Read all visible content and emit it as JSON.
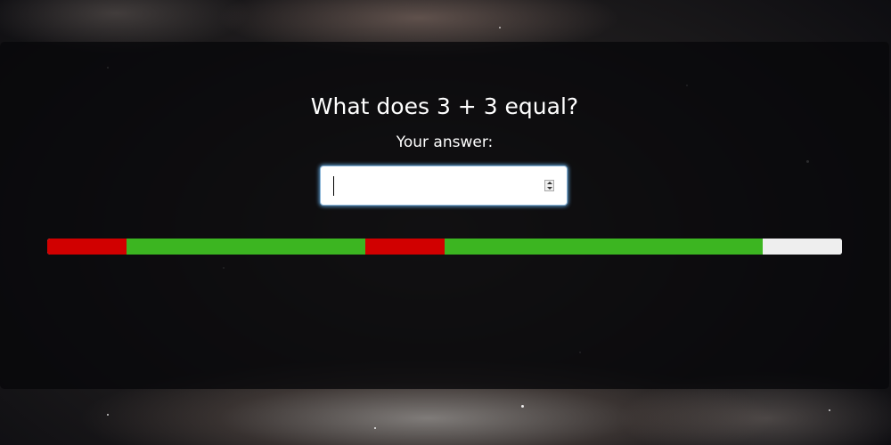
{
  "quiz": {
    "question": "What does 3 + 3 equal?",
    "answer_label": "Your answer:",
    "answer_value": ""
  },
  "progress": {
    "segments": [
      {
        "status": "wrong",
        "fraction": 0.1
      },
      {
        "status": "correct",
        "fraction": 0.3
      },
      {
        "status": "wrong",
        "fraction": 0.1
      },
      {
        "status": "correct",
        "fraction": 0.4
      }
    ],
    "remaining_fraction": 0.1,
    "colors": {
      "wrong": "#d10000",
      "correct": "#3cb521",
      "remaining": "#eeeeee"
    }
  },
  "icons": {
    "spinner": "number-spinner-icon"
  }
}
